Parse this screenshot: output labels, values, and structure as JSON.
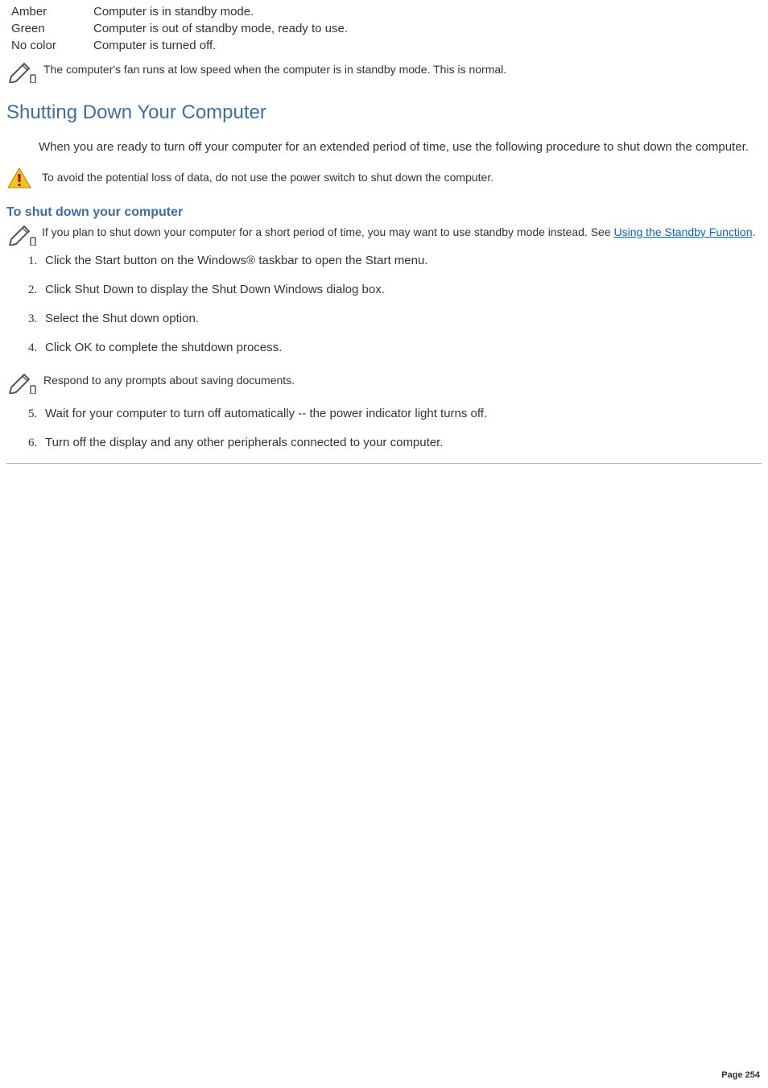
{
  "status_table": {
    "rows": [
      {
        "label": "Amber",
        "desc": "Computer is in standby mode."
      },
      {
        "label": "Green",
        "desc": "Computer is out of standby mode, ready to use."
      },
      {
        "label": "No color",
        "desc": "Computer is turned off."
      }
    ]
  },
  "fan_note": "The computer's fan runs at low speed when the computer is in standby mode. This is normal.",
  "section_title": "Shutting Down Your Computer",
  "intro": "When you are ready to turn off your computer for an extended period of time, use the following procedure to shut down the computer.",
  "warning_text": "To avoid the potential loss of data, do not use the power switch to shut down the computer.",
  "subheading": "To shut down your computer",
  "standby_note_pre": "If you plan to shut down your computer for a short period of time, you may want to use standby mode instead. See ",
  "standby_link": "Using the Standby Function",
  "standby_note_post": ".",
  "steps_a": [
    "Click the Start button on the Windows® taskbar to open the Start menu.",
    "Click Shut Down to display the Shut Down Windows dialog box.",
    "Select the Shut down option.",
    "Click OK to complete the shutdown process."
  ],
  "mid_note": "Respond to any prompts about saving documents.",
  "steps_b": [
    "Wait for your computer to turn off automatically -- the power indicator light turns off.",
    "Turn off the display and any other peripherals connected to your computer."
  ],
  "page_label": "Page 254"
}
